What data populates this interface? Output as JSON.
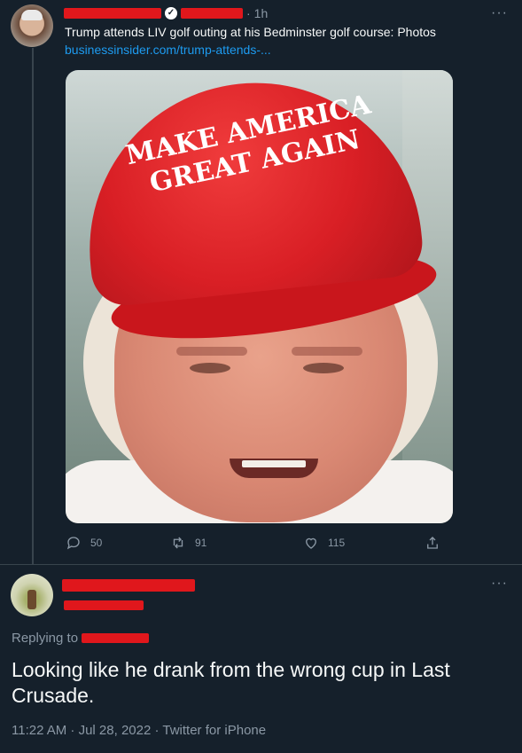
{
  "tweet1": {
    "time": "1h",
    "text": "Trump attends LIV golf outing at his Bedminster golf course: Photos",
    "link": "businessinsider.com/trump-attends-...",
    "cap_line1": "MAKE AMERICA",
    "cap_line2": "GREAT AGAIN",
    "replies": "50",
    "retweets": "91",
    "likes": "115",
    "more": "···"
  },
  "tweet2": {
    "replying_to_label": "Replying to",
    "text": "Looking like he drank from the wrong cup in Last Crusade.",
    "meta": "11:22 AM · Jul 28, 2022 · Twitter for iPhone",
    "more": "···"
  },
  "colors": {
    "background": "#15202b",
    "link": "#1d9bf0",
    "muted": "#8b98a5",
    "redaction": "#e0171c"
  }
}
